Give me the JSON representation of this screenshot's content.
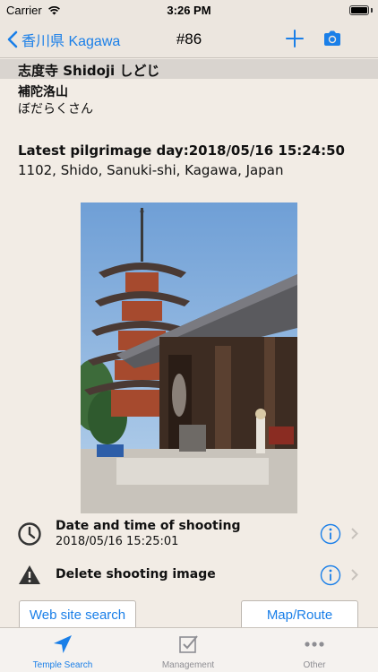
{
  "status_bar": {
    "carrier": "Carrier",
    "time": "3:26 PM",
    "battery_level": 1.0
  },
  "nav": {
    "back_label": "香川県 Kagawa",
    "title": "#86",
    "actions": [
      "plus-icon",
      "camera-icon"
    ]
  },
  "temple": {
    "name_line": "志度寺 Shidoji しどじ",
    "sangou": "補陀洛山",
    "sangou_kana": "ぼだらくさん",
    "latest_day": "Latest pilgrimage day:2018/05/16 15:24:50",
    "address": "1102, Shido, Sanuki-shi, Kagawa, Japan"
  },
  "photo": {
    "subject": "five-storied pagoda and temple gate"
  },
  "rows": {
    "shooting_title": "Date and time of shooting",
    "shooting_value": "2018/05/16 15:25:01",
    "delete_title": "Delete shooting image"
  },
  "buttons": {
    "web": "Web site search",
    "map": "Map/Route"
  },
  "tabs": [
    {
      "label": "Temple Search",
      "icon": "location-arrow-icon",
      "active": true
    },
    {
      "label": "Management",
      "icon": "checkbox-icon",
      "active": false
    },
    {
      "label": "Other",
      "icon": "more-dots-icon",
      "active": false
    }
  ],
  "colors": {
    "accent": "#1a7fe8",
    "background": "#f2ece5",
    "header_bar": "#d9d4cf"
  }
}
